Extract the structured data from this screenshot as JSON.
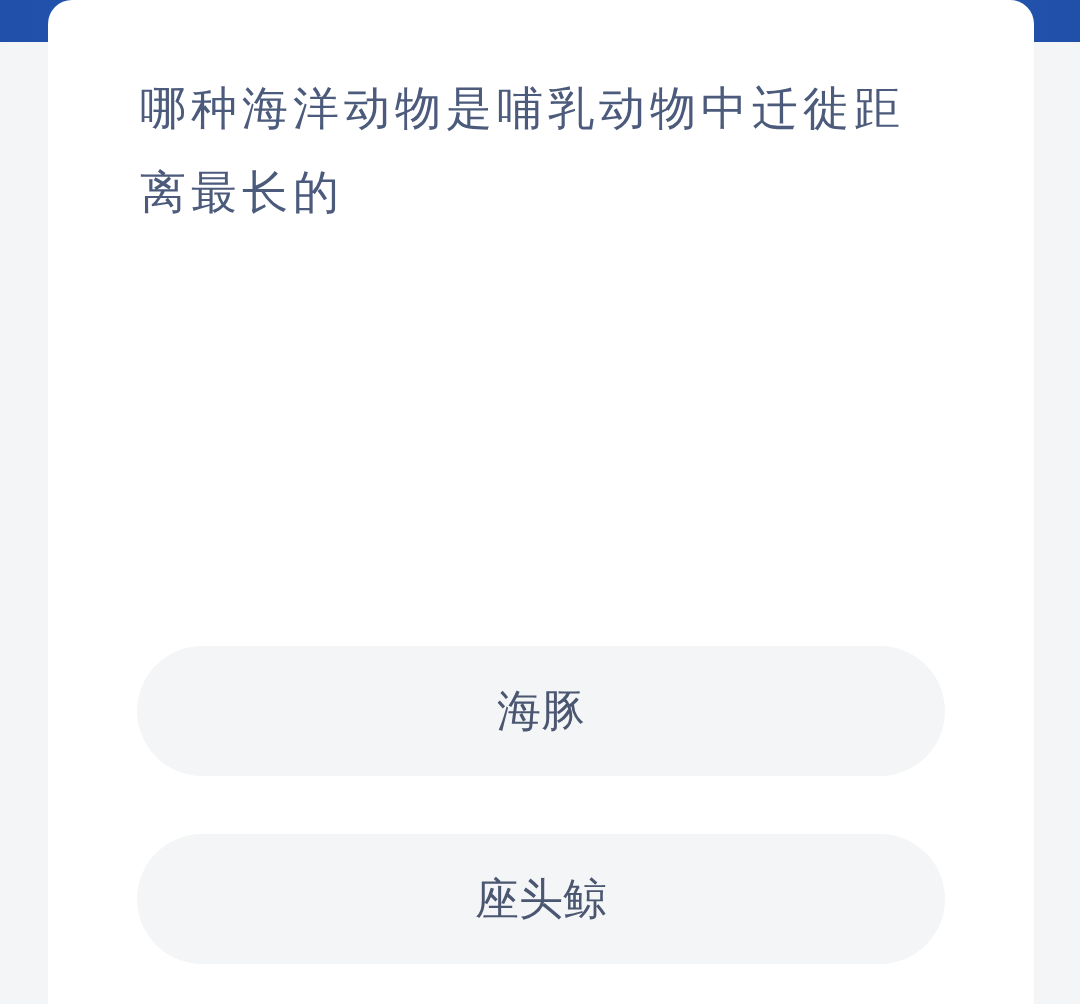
{
  "question": "哪种海洋动物是哺乳动物中迁徙距离最长的",
  "options": [
    {
      "label": "海豚"
    },
    {
      "label": "座头鲸"
    }
  ]
}
